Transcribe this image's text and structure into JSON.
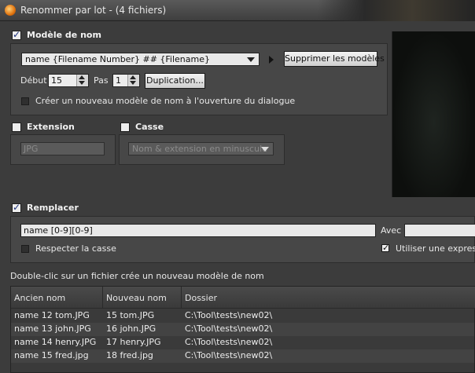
{
  "window": {
    "title": "Renommer par lot - (4 fichiers)"
  },
  "naming": {
    "header": "Modèle de nom",
    "checked": true,
    "template_value": "name {Filename Number} ## {Filename}",
    "delete_templates_label": "Supprimer les modèles",
    "start_label": "Début",
    "start_value": "15",
    "step_label": "Pas",
    "step_value": "1",
    "duplication_label": "Duplication...",
    "new_template_on_open_label": "Créer un nouveau modèle de nom à l'ouverture du dialogue",
    "new_template_on_open_checked": false
  },
  "extension": {
    "header": "Extension",
    "checked": false,
    "value": "JPG"
  },
  "case": {
    "header": "Casse",
    "checked": false,
    "value": "Nom & extension en minuscule"
  },
  "replace": {
    "header": "Remplacer",
    "checked": true,
    "pattern_value": "name [0-9][0-9]",
    "with_label": "Avec",
    "with_value": "",
    "match_case_label": "Respecter la casse",
    "match_case_checked": false,
    "use_regex_label": "Utiliser une expressio",
    "use_regex_checked": true
  },
  "hint": "Double-clic sur un fichier crée un nouveau modèle de nom",
  "table": {
    "columns": [
      "Ancien nom",
      "Nouveau nom",
      "Dossier"
    ],
    "rows": [
      {
        "old": "name 12 tom.JPG",
        "new": "15  tom.JPG",
        "folder": "C:\\Tool\\tests\\new02\\"
      },
      {
        "old": "name 13 john.JPG",
        "new": "16  john.JPG",
        "folder": "C:\\Tool\\tests\\new02\\"
      },
      {
        "old": "name 14 henry.JPG",
        "new": "17  henry.JPG",
        "folder": "C:\\Tool\\tests\\new02\\"
      },
      {
        "old": "name 15 fred.jpg",
        "new": "18  fred.jpg",
        "folder": "C:\\Tool\\tests\\new02\\"
      }
    ]
  }
}
